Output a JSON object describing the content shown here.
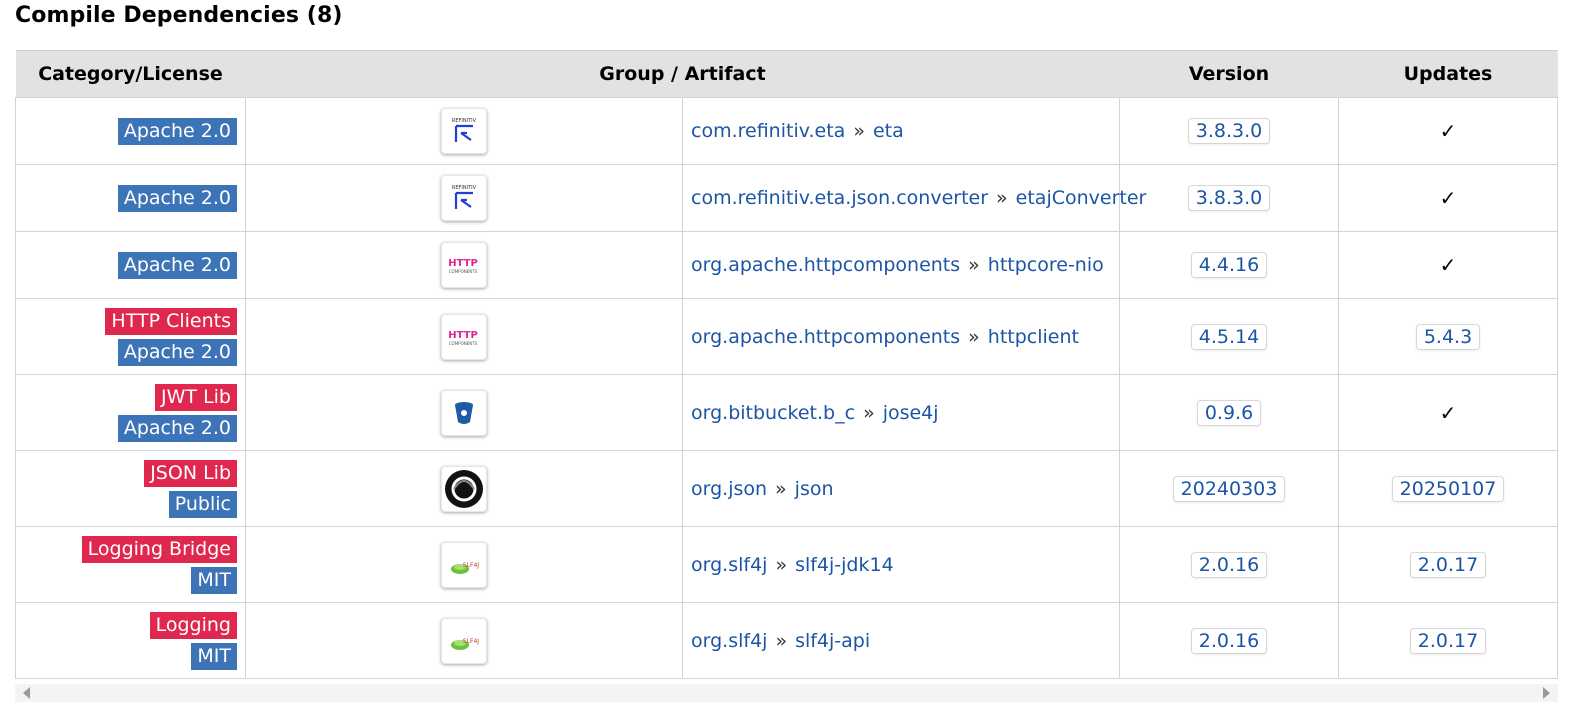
{
  "section_title": "Compile Dependencies (8)",
  "headers": {
    "category_license": "Category/License",
    "group_artifact": "Group / Artifact",
    "version": "Version",
    "updates": "Updates"
  },
  "separator": "»",
  "rows": [
    {
      "categories": [],
      "license": "Apache 2.0",
      "icon": "refinitiv-logo-icon",
      "group": "com.refinitiv.eta",
      "artifact": "eta",
      "version": "3.8.3.0",
      "update": "✓"
    },
    {
      "categories": [],
      "license": "Apache 2.0",
      "icon": "refinitiv-logo-icon",
      "group": "com.refinitiv.eta.json.converter",
      "artifact": "etajConverter",
      "version": "3.8.3.0",
      "update": "✓"
    },
    {
      "categories": [],
      "license": "Apache 2.0",
      "icon": "httpcomponents-logo-icon",
      "group": "org.apache.httpcomponents",
      "artifact": "httpcore-nio",
      "version": "4.4.16",
      "update": "✓"
    },
    {
      "categories": [
        "HTTP Clients"
      ],
      "license": "Apache 2.0",
      "icon": "httpcomponents-logo-icon",
      "group": "org.apache.httpcomponents",
      "artifact": "httpclient",
      "version": "4.5.14",
      "update": "5.4.3"
    },
    {
      "categories": [
        "JWT Lib"
      ],
      "license": "Apache 2.0",
      "icon": "bitbucket-logo-icon",
      "group": "org.bitbucket.b_c",
      "artifact": "jose4j",
      "version": "0.9.6",
      "update": "✓"
    },
    {
      "categories": [
        "JSON Lib"
      ],
      "license": "Public",
      "icon": "json-logo-icon",
      "group": "org.json",
      "artifact": "json",
      "version": "20240303",
      "update": "20250107"
    },
    {
      "categories": [
        "Logging Bridge"
      ],
      "license": "MIT",
      "icon": "slf4j-logo-icon",
      "group": "org.slf4j",
      "artifact": "slf4j-jdk14",
      "version": "2.0.16",
      "update": "2.0.17"
    },
    {
      "categories": [
        "Logging"
      ],
      "license": "MIT",
      "icon": "slf4j-logo-icon",
      "group": "org.slf4j",
      "artifact": "slf4j-api",
      "version": "2.0.16",
      "update": "2.0.17"
    }
  ],
  "colors": {
    "license_badge": "#3d74b8",
    "category_badge": "#e0284f",
    "link": "#1d55a5",
    "header_bg": "#e2e2e2"
  }
}
